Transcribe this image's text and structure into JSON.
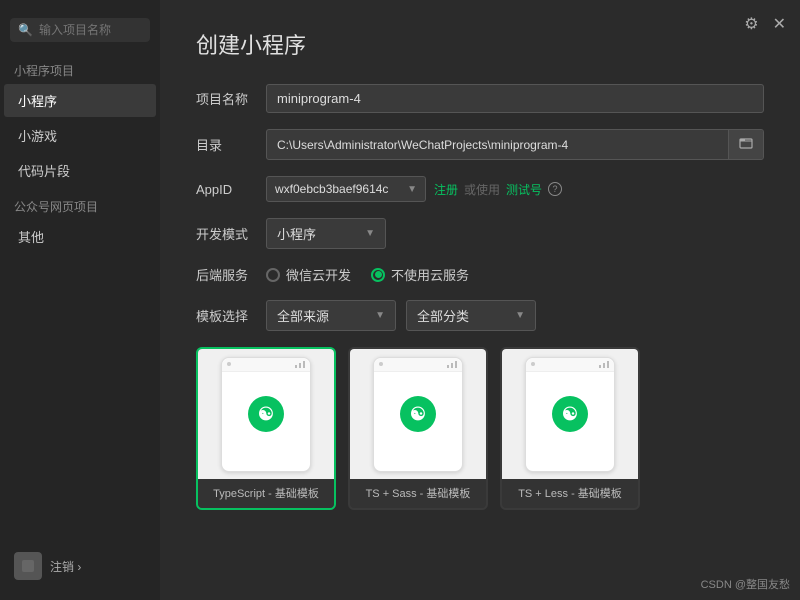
{
  "sidebar": {
    "search_placeholder": "输入项目名称",
    "section1_label": "小程序项目",
    "items": [
      {
        "id": "miniprogram",
        "label": "小程序",
        "active": true
      },
      {
        "id": "minigame",
        "label": "小游戏",
        "active": false
      },
      {
        "id": "codesnippet",
        "label": "代码片段",
        "active": false
      }
    ],
    "section2_label": "公众号网页项目",
    "items2": [
      {
        "id": "other",
        "label": "其他",
        "active": false
      }
    ],
    "logout_label": "注销 ›"
  },
  "topicons": {
    "settings_label": "⚙",
    "close_label": "✕"
  },
  "dialog": {
    "title": "创建小程序",
    "fields": {
      "project_name_label": "项目名称",
      "project_name_value": "miniprogram-4",
      "dir_label": "目录",
      "dir_value": "C:\\Users\\Administrator\\WeChatProjects\\miniprogram-4",
      "appid_label": "AppID",
      "appid_value": "wxf0ebcb3baef9614c",
      "register_label": "注册",
      "or_label": "或使用",
      "testid_label": "测试号",
      "devmode_label": "开发模式",
      "devmode_value": "小程序",
      "backend_label": "后端服务",
      "backend_option1": "微信云开发",
      "backend_option2": "不使用云服务",
      "template_label": "模板选择",
      "source_option": "全部来源",
      "category_option": "全部分类"
    },
    "templates": [
      {
        "id": "ts-basic",
        "label": "TypeScript - 基础模板",
        "selected": true
      },
      {
        "id": "ts-sass-basic",
        "label": "TS + Sass - 基础模板",
        "selected": false
      },
      {
        "id": "ts-less-basic",
        "label": "TS + Less - 基础模板",
        "selected": false
      }
    ]
  },
  "watermark": "CSDN @整国友愁"
}
